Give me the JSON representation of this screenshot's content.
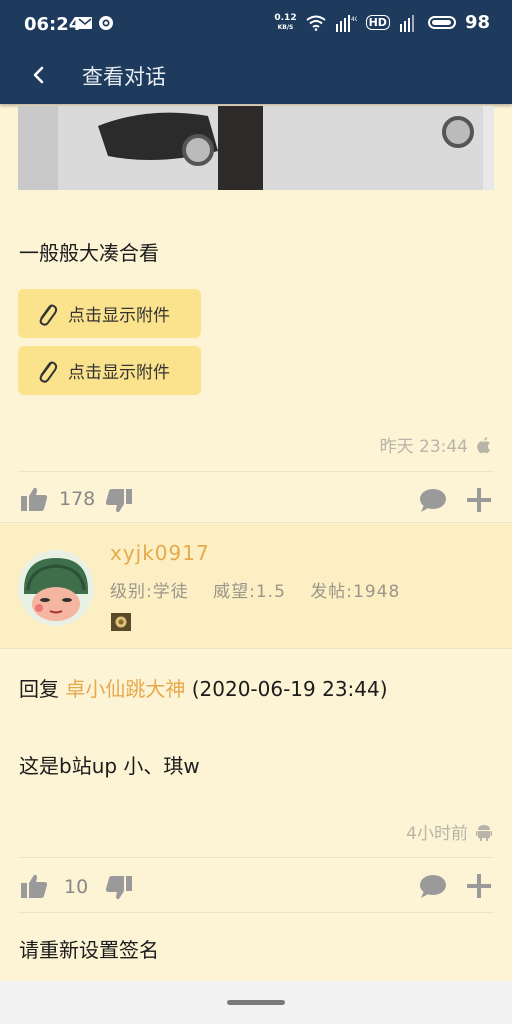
{
  "status_bar": {
    "time": "06:24",
    "net_speed_value": "0.12",
    "net_speed_unit": "KB/S",
    "hd_label": "HD",
    "battery": "98"
  },
  "app_bar": {
    "title": "查看对话"
  },
  "post1": {
    "body": "一般般大凑合看",
    "attachments": [
      "点击显示附件",
      "点击显示附件"
    ],
    "time": "昨天 23:44",
    "likes": "178"
  },
  "reply": {
    "username": "xyjk0917",
    "level": "级别:学徒",
    "prestige": "威望:1.5",
    "posts": "发帖:1948",
    "reply_prefix": "回复",
    "reply_to": "卓小仙跳大神",
    "reply_date": "(2020-06-19 23:44)",
    "body": "这是b站up 小、琪w",
    "time": "4小时前",
    "likes": "10",
    "signature": "请重新设置签名"
  },
  "colors": {
    "header_bg": "#1e3a5c",
    "page_bg": "#fdf3d5",
    "accent": "#e6a94e",
    "attachment_bg": "#fbe28d"
  }
}
